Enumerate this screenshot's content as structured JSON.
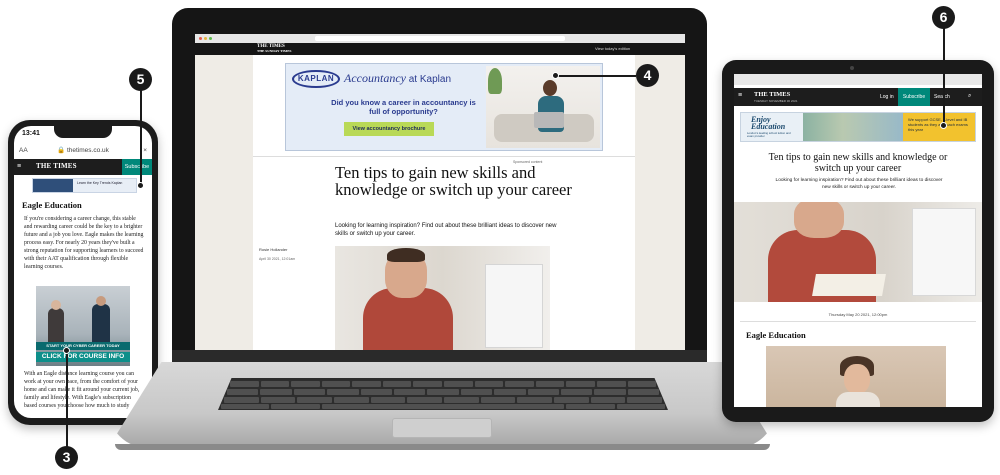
{
  "phone": {
    "status_time": "13:41",
    "url_prefix": "AA",
    "url": "thetimes.co.uk",
    "logo": "THE TIMES",
    "subscribe": "Subscribe",
    "ad_text": "Learn the Key Trends Kaplan",
    "heading": "Eagle Education",
    "para1": "If you're considering a career change, this stable and rewarding career could be the key to a brighter future and a job you love. Eagle makes the learning process easy. For nearly 20 years they've built a strong reputation for supporting learners to succeed with their AAT qualification through flexible learning courses.",
    "image_band": "START YOUR CYBER CAREER TODAY",
    "image_cta": "CLICK FOR COURSE INFO",
    "para2": "With an Eagle distance learning course you can work at your own pace, from the comfort of your home and can make it fit around your current job, family and lifestyle. With Eagle's subscription based courses you choose how much to study"
  },
  "laptop": {
    "logo": "THE TIMES",
    "logo_sub": "THE SUNDAY TIMES",
    "todays_edition": "View today's edition",
    "ad": {
      "brand": "KAPLAN",
      "tagline_script": "Accountancy",
      "tagline_rest": " at Kaplan",
      "question": "Did you know a career in accountancy is full of opportunity?",
      "button": "View accountancy brochure"
    },
    "sponsored": "Sponsored content",
    "title": "Ten tips to gain new skills and knowledge or switch up your career",
    "standfirst": "Looking for learning inspiration? Find out about these brilliant ideas to discover new skills or switch up your career.",
    "author": "Rosie Hollander",
    "date": "April 30 2021, 12:01am"
  },
  "tablet": {
    "logo": "THE TIMES",
    "logo_sub": "TUESDAY NOVEMBER 30 2021",
    "login": "Log in",
    "subscribe": "Subscribe",
    "search": "Search",
    "ad": {
      "enjoy": "Enjoy",
      "education": "Education",
      "sub": "London's leading school tuition and exam provider",
      "yellow": "We support GCSE, A level and IB students as they approach exams this year"
    },
    "title": "Ten tips to gain new skills and knowledge or switch up your career",
    "standfirst": "Looking for learning inspiration? Find out about these brilliant ideas to discover new skills or switch up your career.",
    "date": "Thursday May 20 2021, 12:00pm",
    "section_heading": "Eagle Education"
  },
  "callouts": {
    "phone_top": "5",
    "phone_bottom": "3",
    "laptop": "4",
    "tablet": "6"
  }
}
